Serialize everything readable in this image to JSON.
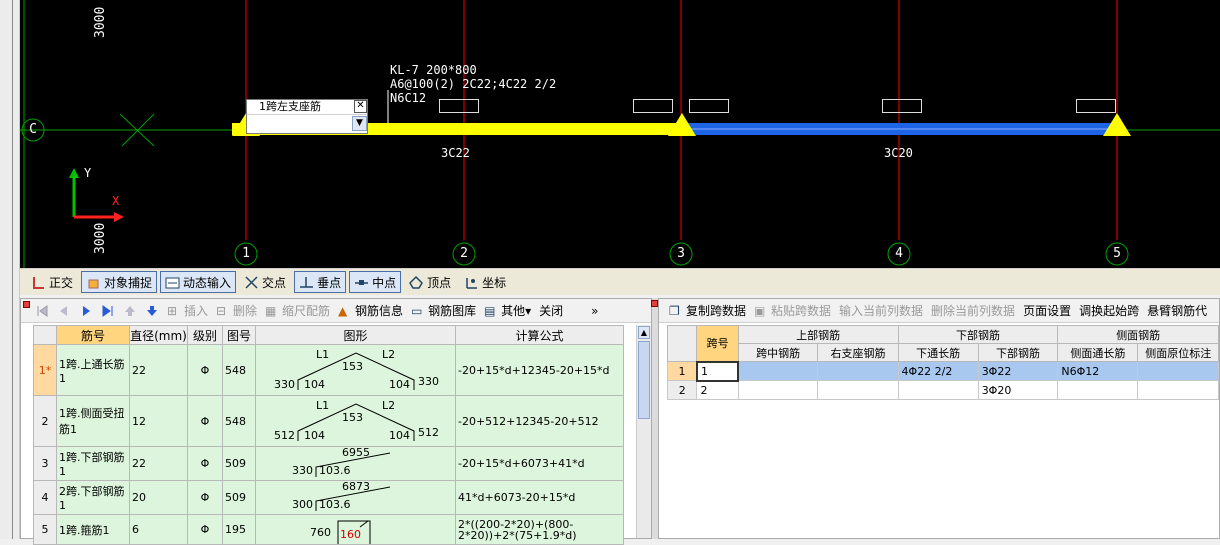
{
  "cad": {
    "beam_text": [
      "KL-7 200*800",
      "A6@100(2) 2C22;4C22 2/2",
      "N6C12"
    ],
    "span1_bottom_label": "3C22",
    "span2_bottom_label": "3C20",
    "axis_labels": [
      "1",
      "2",
      "3",
      "4",
      "5"
    ],
    "row_axis_label": "C",
    "dim_top": "3000",
    "dim_bottom": "3000",
    "ucs_x": "X",
    "ucs_y": "Y",
    "colors": {
      "beam_yellow": "#ffff00",
      "beam_blue": "#1e64e6",
      "axis_red": "#ff0000",
      "grid_green": "#00a000"
    }
  },
  "popup": {
    "title": "1跨左支座筋",
    "value": "",
    "close": "✕"
  },
  "snapbar": {
    "items": [
      {
        "label": "正交",
        "pressed": false
      },
      {
        "label": "对象捕捉",
        "pressed": true
      },
      {
        "label": "动态输入",
        "pressed": true
      },
      {
        "label": "交点",
        "pressed": false
      },
      {
        "label": "垂点",
        "pressed": true
      },
      {
        "label": "中点",
        "pressed": true
      },
      {
        "label": "顶点",
        "pressed": false
      },
      {
        "label": "坐标",
        "pressed": false
      }
    ]
  },
  "left_toolbar": {
    "insert": "插入",
    "delete": "删除",
    "scale": "缩尺配筋",
    "info": "钢筋信息",
    "library": "钢筋图库",
    "other": "其他",
    "close": "关闭"
  },
  "rebar_table": {
    "headers": [
      "筋号",
      "直径(mm)",
      "级别",
      "图号",
      "图形",
      "计算公式"
    ],
    "rows": [
      {
        "num": "1*",
        "name": "1跨.上通长筋1",
        "dia": "22",
        "grade": "Φ",
        "fig": "548",
        "formula": "-20+15*d+12345-20+15*d",
        "shape": {
          "L1": "L1",
          "L2": "L2",
          "mid": "153",
          "left_h": "330",
          "left_w": "104",
          "right_w": "104",
          "right_h": "330"
        }
      },
      {
        "num": "2",
        "name": "1跨.侧面受扭筋1",
        "dia": "12",
        "grade": "Φ",
        "fig": "548",
        "formula": "-20+512+12345-20+512",
        "shape": {
          "L1": "L1",
          "L2": "L2",
          "mid": "153",
          "left_h": "512",
          "left_w": "104",
          "right_w": "104",
          "right_h": "512"
        }
      },
      {
        "num": "3",
        "name": "1跨.下部钢筋1",
        "dia": "22",
        "grade": "Φ",
        "fig": "509",
        "formula": "-20+15*d+6073+41*d",
        "shape": {
          "len": "6955",
          "h": "330",
          "w": "103.6"
        }
      },
      {
        "num": "4",
        "name": "2跨.下部钢筋1",
        "dia": "20",
        "grade": "Φ",
        "fig": "509",
        "formula": "41*d+6073-20+15*d",
        "shape": {
          "len": "6873",
          "h": "300",
          "w": "103.6"
        }
      },
      {
        "num": "5",
        "name": "1跨.箍筋1",
        "dia": "6",
        "grade": "Φ",
        "fig": "195",
        "formula": "2*((200-2*20)+(800-2*20))+2*(75+1.9*d)",
        "shape": {
          "len": "760",
          "w": "160"
        }
      }
    ]
  },
  "right_toolbar": {
    "copy": "复制跨数据",
    "paste": "粘贴跨数据",
    "input_col": "输入当前列数据",
    "delete_col": "删除当前列数据",
    "page_setup": "页面设置",
    "swap_start": "调换起始跨",
    "cantilever": "悬臂钢筋代"
  },
  "span_table": {
    "span_no": "跨号",
    "group_top": "上部钢筋",
    "group_bottom": "下部钢筋",
    "group_side": "侧面钢筋",
    "cols": [
      "跨中钢筋",
      "右支座钢筋",
      "下通长筋",
      "下部钢筋",
      "侧面通长筋",
      "侧面原位标注"
    ],
    "rows": [
      {
        "idx": "1",
        "span": "1",
        "mid": "",
        "right": "",
        "bot_thru": "4Φ22 2/2",
        "bottom": "3Φ22",
        "side_thru": "N6Φ12",
        "side_orig": ""
      },
      {
        "idx": "2",
        "span": "2",
        "mid": "",
        "right": "",
        "bot_thru": "",
        "bottom": "3Φ20",
        "side_thru": "",
        "side_orig": ""
      }
    ]
  }
}
